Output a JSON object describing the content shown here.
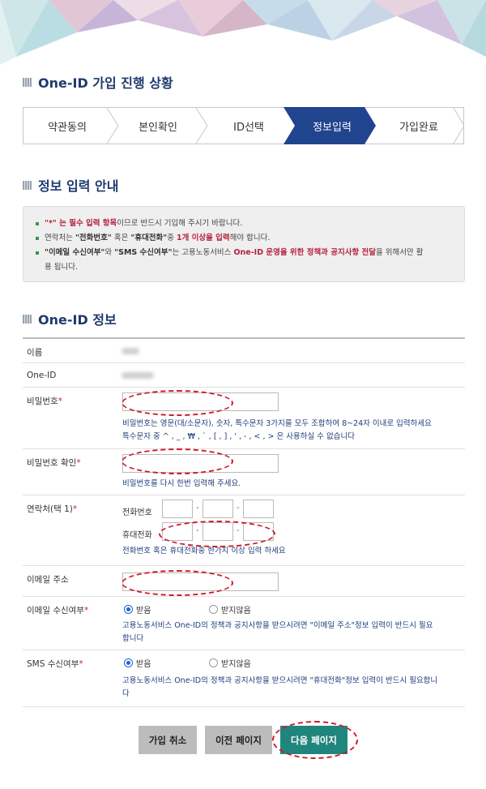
{
  "progress": {
    "title": "One-ID 가입 진행 상황",
    "steps": [
      {
        "label": "약관동의",
        "active": false
      },
      {
        "label": "본인확인",
        "active": false
      },
      {
        "label": "ID선택",
        "active": false
      },
      {
        "label": "정보입력",
        "active": true
      },
      {
        "label": "가입완료",
        "active": false
      }
    ]
  },
  "guide": {
    "title": "정보 입력 안내",
    "items": [
      {
        "p1": "\"*\" 는 필수 입력 항목",
        "p2": "이므로 반드시 기입해 주시기 바랍니다."
      },
      {
        "p1": "연락처는 ",
        "p2": "\"전화번호\"",
        "p3": " 혹은 ",
        "p4": "\"휴대전화\"",
        "p5": "중 ",
        "p6": "1개 이상을 입력",
        "p7": "해야 합니다."
      },
      {
        "p1": "\"이메일 수신여부\"",
        "p2": "와 ",
        "p3": "\"SMS 수신여부\"",
        "p4": "는 고용노동서비스 ",
        "p5": "One-ID 운영을 위한 정책과 공지사항 전달",
        "p6": "을 위해서만 활",
        "p7": "용 됩니다."
      }
    ]
  },
  "form": {
    "title": "One-ID 정보",
    "required_mark": "*",
    "name_label": "이름",
    "oneid_label": "One-ID",
    "password_label": "비밀번호",
    "password_help1": "비밀번호는 영문(대/소문자), 숫자, 특수문자 3가지를 모두 조합하여 8~24자 이내로 입력하세요",
    "password_help2": "특수문자 중 ^ , _ , ₩ , ` , [ , ] , ' , - , < , > 은 사용하실 수 없습니다",
    "password_confirm_label": "비밀번호 확인",
    "password_confirm_help": "비밀번호를 다시 한번 입력해 주세요.",
    "contact_label": "연락처(택 1)",
    "phone_label": "전화번호",
    "mobile_label": "휴대전화",
    "contact_help": "전화번호 혹은 휴대전화중 한가지 이상 입력 하세요",
    "email_label": "이메일 주소",
    "email_consent_label": "이메일 수신여부",
    "sms_consent_label": "SMS 수신여부",
    "receive": "받음",
    "not_receive": "받지않음",
    "email_help1": "고용노동서비스 One-ID의 정책과 공지사항을 받으시려면 \"이메일 주소\"정보 입력이 반드시 필요",
    "email_help2": "합니다",
    "sms_help1": "고용노동서비스 One-ID의 정책과 공지사항을 받으시려면 \"휴대전화\"정보 입력이 반드시 필요합니",
    "sms_help2": "다"
  },
  "buttons": {
    "cancel": "가입 취소",
    "prev": "이전 페이지",
    "next": "다음 페이지"
  }
}
